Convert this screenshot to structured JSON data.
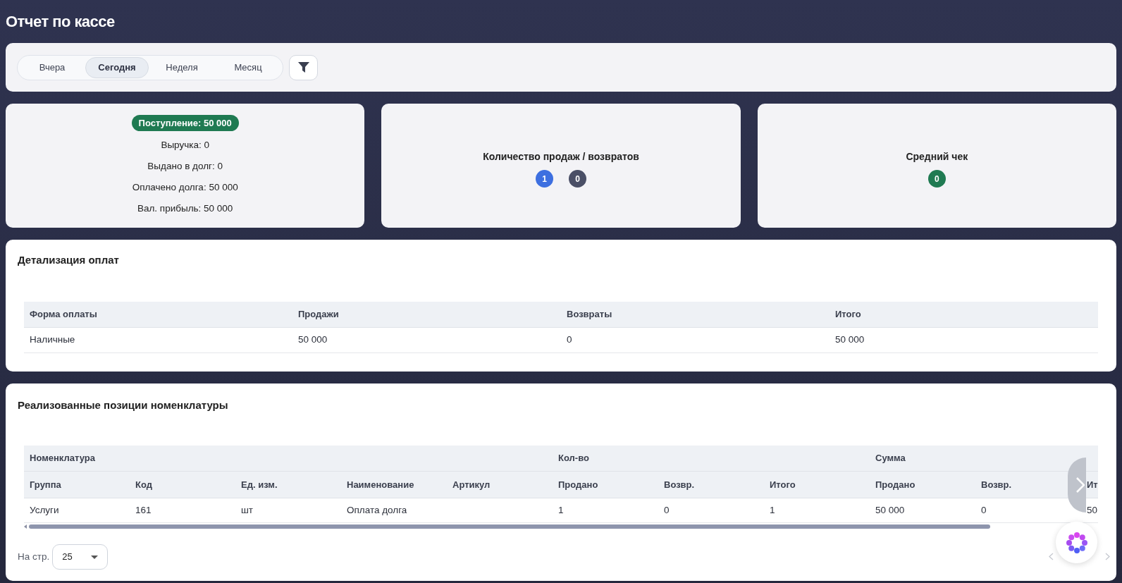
{
  "page_title": "Отчет по кассе",
  "period_tabs": [
    {
      "label": "Вчера",
      "selected": false
    },
    {
      "label": "Сегодня",
      "selected": true
    },
    {
      "label": "Неделя",
      "selected": false
    },
    {
      "label": "Месяц",
      "selected": false
    }
  ],
  "summary": {
    "badge": "Поступление: 50 000",
    "lines": [
      "Выручка: 0",
      "Выдано в долг: 0",
      "Оплачено долга: 50 000",
      "Вал. прибыль: 50 000"
    ]
  },
  "counts": {
    "title": "Количество продаж / возвратов",
    "badges": [
      {
        "text": "1",
        "color": "#3d6fe0"
      },
      {
        "text": "0",
        "color": "#4a4f66"
      }
    ]
  },
  "average": {
    "title": "Средний чек",
    "badges": [
      {
        "text": "0",
        "color": "#1f7a52"
      }
    ]
  },
  "payments": {
    "title": "Детализация оплат",
    "columns": [
      "Форма оплаты",
      "Продажи",
      "Возвраты",
      "Итого"
    ],
    "rows": [
      [
        "Наличные",
        "50 000",
        "0",
        "50 000"
      ]
    ]
  },
  "items": {
    "title": "Реализованные позиции номенклатуры",
    "column_groups": [
      {
        "label": "Номенклатура",
        "columns": [
          "Группа",
          "Код",
          "Ед. изм.",
          "Наименование",
          "Артикул"
        ]
      },
      {
        "label": "Кол-во",
        "columns": [
          "Продано",
          "Возвр.",
          "Итого"
        ]
      },
      {
        "label": "Сумма",
        "columns": [
          "Продано",
          "Возвр.",
          "Ит"
        ]
      }
    ],
    "rows": [
      [
        "Услуги",
        "161",
        "шт",
        "Оплата долга",
        null,
        "1",
        "0",
        "1",
        "50 000",
        "0",
        "50"
      ]
    ]
  },
  "per_page": {
    "label": "На стр.",
    "value": "25"
  }
}
